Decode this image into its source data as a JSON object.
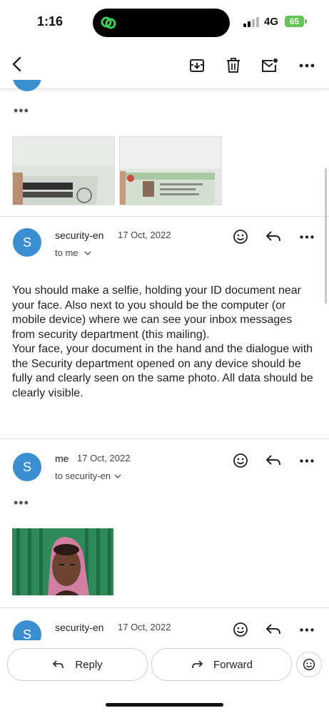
{
  "status_bar": {
    "time": "1:16",
    "network": "4G",
    "battery": "65"
  },
  "toolbar": {
    "back_icon": "chevron-left-icon",
    "archive_icon": "archive-icon",
    "delete_icon": "trash-icon",
    "mark_unread_icon": "mail-unread-icon",
    "more_icon": "more-horizontal-icon"
  },
  "messages": [
    {
      "sender": "security-en",
      "date": "17 Oct, 2022",
      "recipient": "to me",
      "body": [
        "You should make a selfie, holding your ID document near your face. Also next to you should be the computer (or mobile device) where we can see your inbox messages from security department (this mailing).",
        "Your face, your document in the hand and the dialogue with the Security department opened on any device should be fully and clearly seen on the same photo. All data should be clearly visible."
      ],
      "avatar_letter": "S"
    },
    {
      "sender": "me",
      "date": "17 Oct, 2022",
      "recipient": "to security-en",
      "avatar_letter": "S"
    },
    {
      "sender": "security-en",
      "date": "17 Oct, 2022",
      "avatar_letter": "S"
    }
  ],
  "quoted_ellipsis": "•••",
  "actions": {
    "reply": "Reply",
    "forward": "Forward"
  },
  "colors": {
    "avatar": "#3b8fd0",
    "battery": "#63c354"
  }
}
